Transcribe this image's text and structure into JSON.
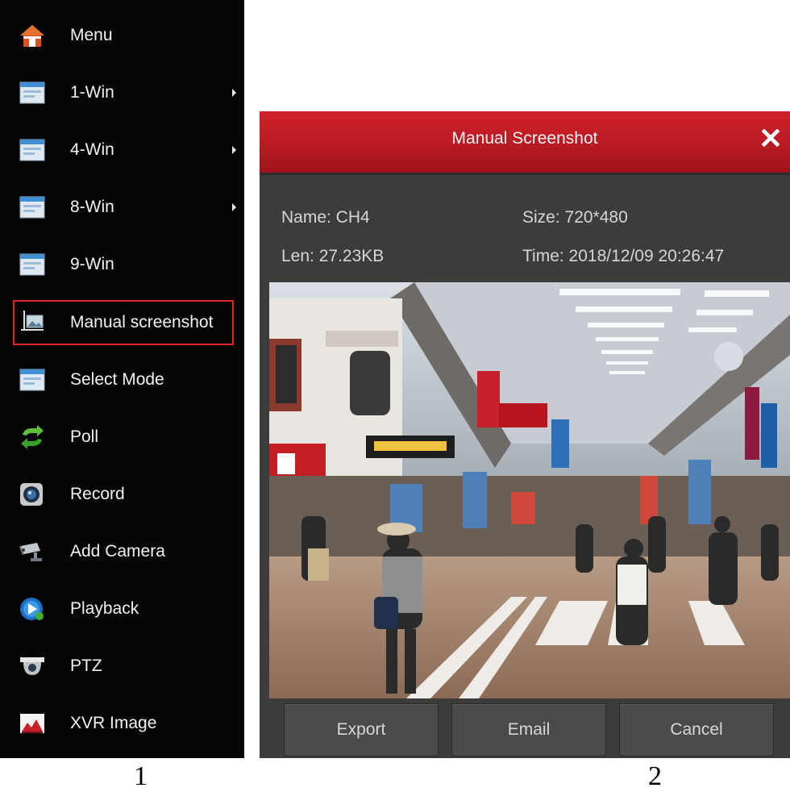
{
  "menu": {
    "items": [
      {
        "label": "Menu",
        "icon": "home-icon",
        "arrow": false
      },
      {
        "label": "1-Win",
        "icon": "window-icon",
        "arrow": true
      },
      {
        "label": "4-Win",
        "icon": "window-icon",
        "arrow": true
      },
      {
        "label": "8-Win",
        "icon": "window-icon",
        "arrow": true
      },
      {
        "label": "9-Win",
        "icon": "window-icon",
        "arrow": false
      },
      {
        "label": "Manual screenshot",
        "icon": "screenshot-icon",
        "arrow": false,
        "highlighted": true
      },
      {
        "label": "Select Mode",
        "icon": "window-icon",
        "arrow": false
      },
      {
        "label": "Poll",
        "icon": "poll-arrows-icon",
        "arrow": false
      },
      {
        "label": "Record",
        "icon": "record-icon",
        "arrow": false
      },
      {
        "label": "Add Camera",
        "icon": "camera-icon",
        "arrow": false
      },
      {
        "label": "Playback",
        "icon": "playback-icon",
        "arrow": false
      },
      {
        "label": "PTZ",
        "icon": "ptz-dome-icon",
        "arrow": false
      },
      {
        "label": "XVR Image",
        "icon": "xvr-image-icon",
        "arrow": false
      }
    ]
  },
  "dialog": {
    "title": "Manual Screenshot",
    "close_symbol": "✕",
    "name": "Name:  CH4",
    "size": "Size:  720*480",
    "len": "Len:  27.23KB",
    "time": "Time:  2018/12/09 20:26:47",
    "buttons": {
      "export": "Export",
      "email": "Email",
      "cancel": "Cancel"
    }
  },
  "figure_labels": {
    "left": "1",
    "right": "2"
  },
  "colors": {
    "accent_red": "#c81b24",
    "highlight_border": "#e02323",
    "menu_bg": "#050505",
    "dialog_bg": "#3c3c3c"
  }
}
